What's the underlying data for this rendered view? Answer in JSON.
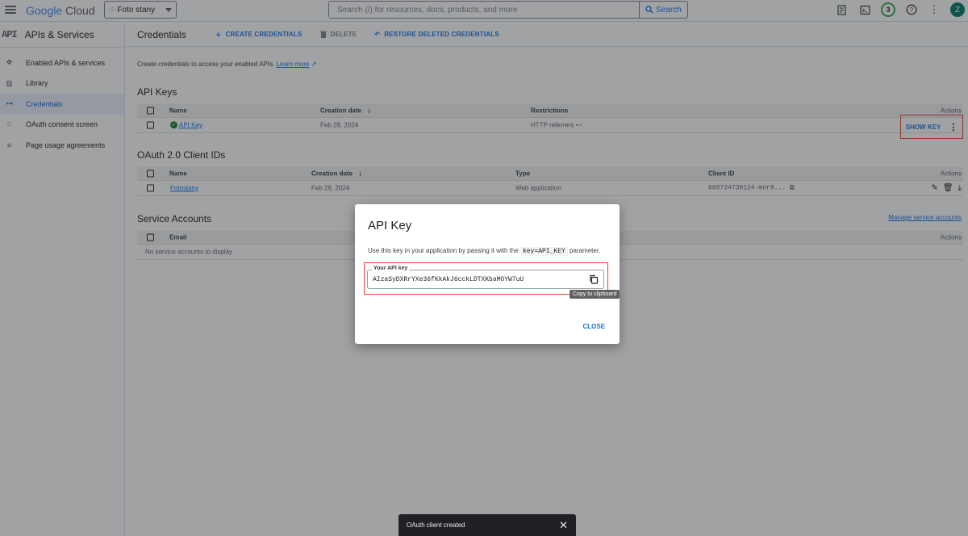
{
  "topbar": {
    "logo": {
      "google": "Google",
      "cloud": "Cloud"
    },
    "project": "Foto stany",
    "search_placeholder": "Search (/) for resources, docs, products, and more",
    "search_button": "Search",
    "notification_count": "3",
    "avatar_initial": "Z",
    "icons": [
      "menu-icon",
      "notes-icon",
      "terminal-icon",
      "help-icon",
      "more-vert-icon"
    ]
  },
  "sidebar": {
    "logo": "API",
    "title": "APIs & Services",
    "items": [
      {
        "label": "Enabled APIs & services",
        "icon": "diamond-icon"
      },
      {
        "label": "Library",
        "icon": "library-icon"
      },
      {
        "label": "Credentials",
        "icon": "key-icon",
        "active": true
      },
      {
        "label": "OAuth consent screen",
        "icon": "oauth-icon"
      },
      {
        "label": "Page usage agreements",
        "icon": "settings-list-icon"
      }
    ]
  },
  "main": {
    "title": "Credentials",
    "toolbar": {
      "create": "CREATE CREDENTIALS",
      "delete": "DELETE",
      "restore": "RESTORE DELETED CREDENTIALS"
    },
    "intro": "Create credentials to access your enabled APIs.",
    "learn_more": "Learn more"
  },
  "api_keys": {
    "title": "API Keys",
    "columns": [
      "Name",
      "Creation date",
      "Restrictions",
      "Actions"
    ],
    "rows": [
      {
        "name": "API Key",
        "date": "Feb 28, 2024",
        "restrictions": "HTTP referrers",
        "action": "SHOW KEY"
      }
    ]
  },
  "oauth": {
    "title": "OAuth 2.0 Client IDs",
    "columns": [
      "Name",
      "Creation date",
      "Type",
      "Client ID",
      "Actions"
    ],
    "rows": [
      {
        "name": "Fotostany",
        "date": "Feb 28, 2024",
        "type": "Web application",
        "client_id": "660724730124-mor8..."
      }
    ]
  },
  "service_accounts": {
    "title": "Service Accounts",
    "manage_link": "Manage service accounts",
    "columns": [
      "Email",
      "Actions"
    ],
    "empty": "No service accounts to display"
  },
  "dialog": {
    "title": "API Key",
    "text_before": "Use this key in your application by passing it with the",
    "code": "key=API_KEY",
    "text_after": "parameter.",
    "field_label": "Your API key",
    "key_value": "AIzaSyDXRrYXe36fKkAkJ6cckLDTXKbaMOYW7uU",
    "tooltip": "Copy to clipboard",
    "close": "CLOSE"
  },
  "snackbar": {
    "message": "OAuth client created"
  },
  "colors": {
    "accent": "#1a73e8",
    "highlight": "#ea4335",
    "active_bg": "#e8f0fe"
  }
}
